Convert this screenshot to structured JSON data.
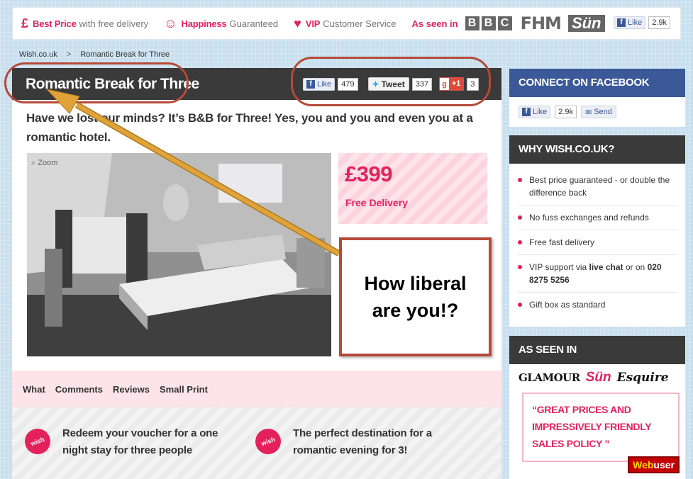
{
  "topbar": {
    "usps": [
      {
        "icon": "pound-icon",
        "glyph": "£",
        "highlight": "Best Price",
        "rest": "with free delivery"
      },
      {
        "icon": "smiley-icon",
        "glyph": "☺",
        "highlight": "Happiness",
        "rest": "Guaranteed"
      },
      {
        "icon": "heart-icon",
        "glyph": "♥",
        "highlight": "VIP",
        "rest": "Customer Service"
      }
    ],
    "as_seen_in": "As seen in",
    "logos": {
      "bbc": [
        "B",
        "B",
        "C"
      ],
      "fhm": "FHM",
      "sun": "Sün"
    },
    "fb_like": "Like",
    "fb_count": "2.9k"
  },
  "breadcrumb": {
    "home": "Wish.co.uk",
    "separator": ">",
    "current": "Romantic Break for Three"
  },
  "product": {
    "title": "Romantic Break for Three",
    "social": {
      "like": "Like",
      "like_count": "479",
      "tweet": "Tweet",
      "tweet_count": "337",
      "gplus": "+1",
      "gplus_count": "3"
    },
    "subtitle": "Have we lost our minds? It’s B&B for Three! Yes, you and you and even you at a romantic hotel.",
    "zoom": "Zoom",
    "price": "£399",
    "delivery": "Free Delivery"
  },
  "tabs": [
    "What",
    "Comments",
    "Reviews",
    "Small Print"
  ],
  "features": [
    {
      "badge": "wish",
      "text": "Redeem your voucher for a one night stay for three people"
    },
    {
      "badge": "wish",
      "text": "The perfect destination for a romantic evening for 3!"
    }
  ],
  "sidebar": {
    "facebook": {
      "heading": "CONNECT ON FACEBOOK",
      "like": "Like",
      "count": "2.9k",
      "send": "Send"
    },
    "why": {
      "heading": "WHY WISH.CO.UK?",
      "items": [
        {
          "text": "Best price guaranteed - or double the difference back"
        },
        {
          "text": "No fuss exchanges and refunds"
        },
        {
          "text": "Free fast delivery"
        },
        {
          "pre": "VIP support via ",
          "bold": "live chat",
          "post": " or on ",
          "bold2": "020 8275 5256"
        },
        {
          "text": "Gift box as standard"
        }
      ]
    },
    "seen": {
      "heading": "AS SEEN IN",
      "logos": [
        "GLAMOUR",
        "Sün",
        "Esquire"
      ],
      "quote": "“GREAT PRICES AND IMPRESSIVELY FRIENDLY SALES POLICY ”",
      "source_a": "Web",
      "source_b": "user"
    }
  },
  "annotation": {
    "callout": "How liberal are you!?",
    "color": "#b44a38",
    "arrow_color": "#e0a33a"
  },
  "colors": {
    "brand_pink": "#e3225c",
    "dark_bar": "#3a3a3a",
    "facebook_blue": "#3b5998"
  }
}
